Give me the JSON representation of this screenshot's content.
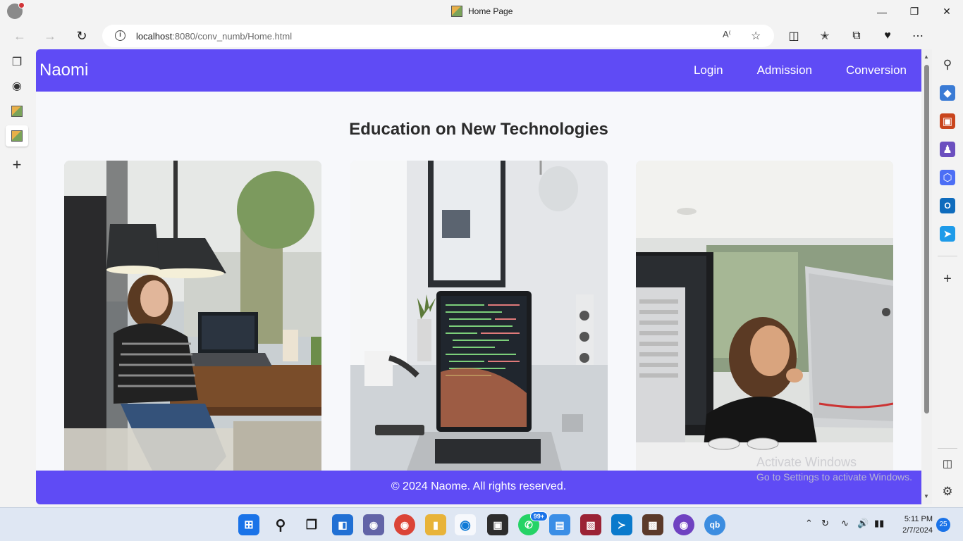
{
  "window": {
    "title": "Home Page"
  },
  "toolbar": {
    "url_host": "localhost",
    "url_rest": ":8080/conv_numb/Home.html"
  },
  "site": {
    "brand": "Naomi",
    "nav": [
      "Login",
      "Admission",
      "Conversion"
    ],
    "heading": "Education on New Technologies",
    "footer": "© 2024 Naome. All rights reserved."
  },
  "watermark": {
    "line1": "Activate Windows",
    "line2": "Go to Settings to activate Windows."
  },
  "taskbar": {
    "whatsapp_badge": "99+",
    "time": "5:11 PM",
    "date": "2/7/2024",
    "notifications": "25"
  },
  "colors": {
    "brand": "#5f4bf5",
    "page_bg": "#f7f8fb"
  }
}
